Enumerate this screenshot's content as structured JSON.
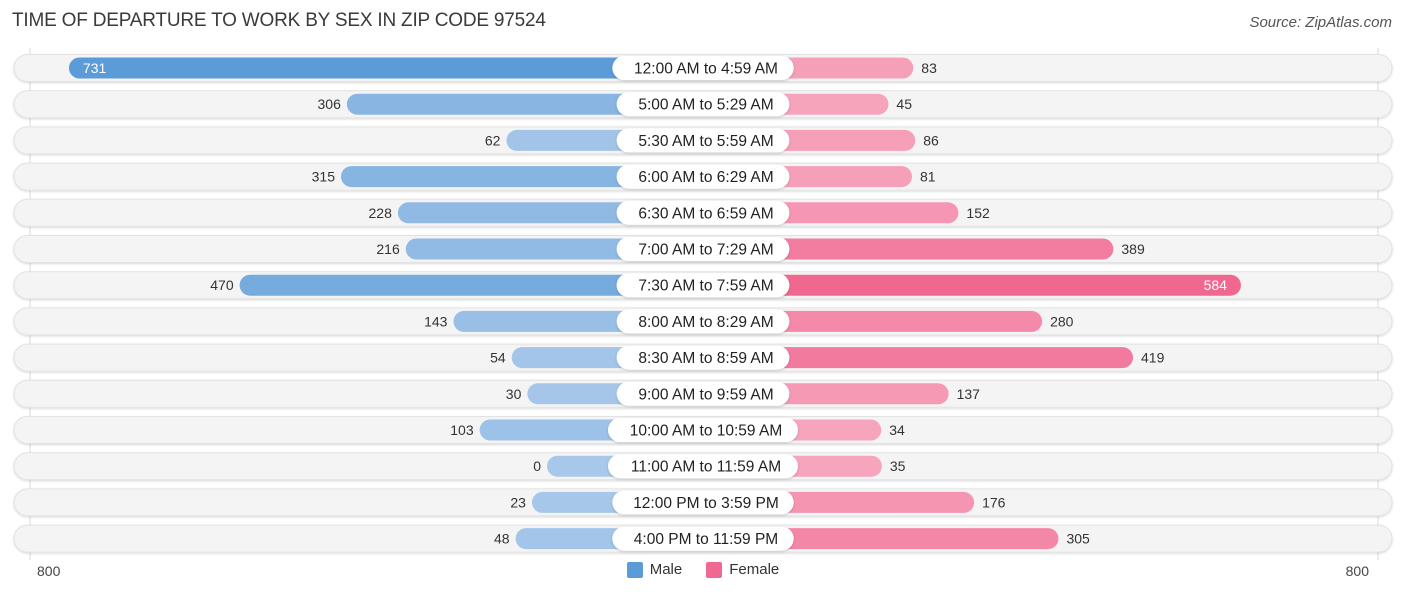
{
  "chart_data": {
    "type": "bar",
    "orientation": "horizontal-diverging",
    "title": "TIME OF DEPARTURE TO WORK BY SEX IN ZIP CODE 97524",
    "source": "Source: ZipAtlas.com",
    "categories": [
      "12:00 AM to 4:59 AM",
      "5:00 AM to 5:29 AM",
      "5:30 AM to 5:59 AM",
      "6:00 AM to 6:29 AM",
      "6:30 AM to 6:59 AM",
      "7:00 AM to 7:29 AM",
      "7:30 AM to 7:59 AM",
      "8:00 AM to 8:29 AM",
      "8:30 AM to 8:59 AM",
      "9:00 AM to 9:59 AM",
      "10:00 AM to 10:59 AM",
      "11:00 AM to 11:59 AM",
      "12:00 PM to 3:59 PM",
      "4:00 PM to 11:59 PM"
    ],
    "series": [
      {
        "name": "Male",
        "color": "#5b9bd8",
        "light_color": "#a8c8ea",
        "values": [
          731,
          306,
          62,
          315,
          228,
          216,
          470,
          143,
          54,
          30,
          103,
          0,
          23,
          48
        ]
      },
      {
        "name": "Female",
        "color": "#f06890",
        "light_color": "#f7a8c0",
        "values": [
          83,
          45,
          86,
          81,
          152,
          389,
          584,
          280,
          419,
          137,
          34,
          35,
          176,
          305
        ]
      }
    ],
    "axis": {
      "left_label": "800",
      "right_label": "800",
      "max": 800
    },
    "legend": {
      "position": "bottom-center",
      "items": [
        "Male",
        "Female"
      ]
    },
    "grid": false
  }
}
